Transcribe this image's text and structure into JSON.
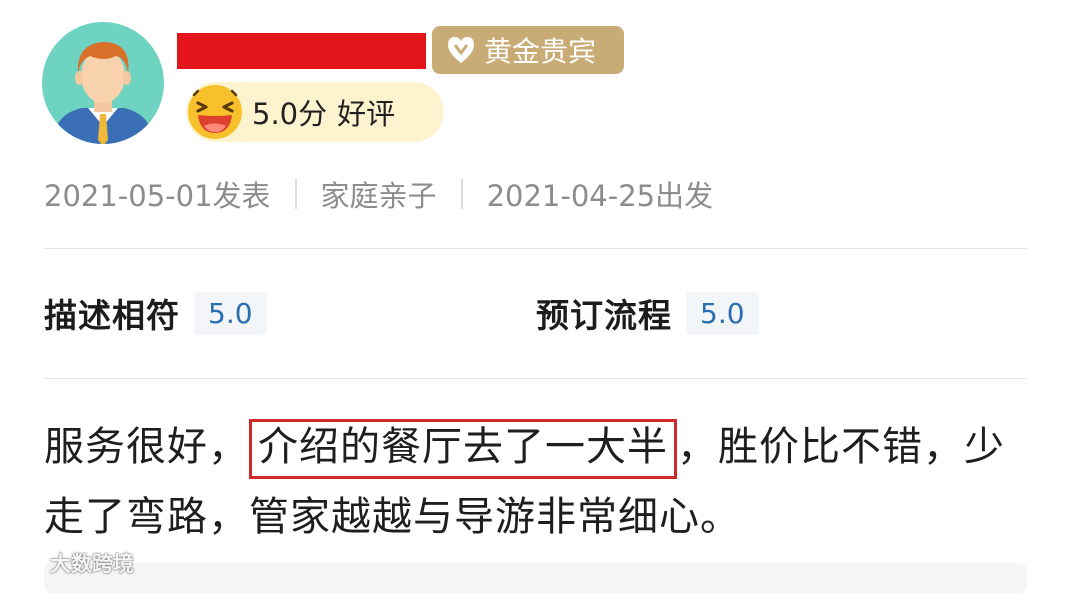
{
  "header": {
    "badge_label": "黄金贵宾",
    "rating_score": "5.0分",
    "rating_verdict": "好评"
  },
  "meta": {
    "posted": "2021-05-01发表",
    "trip_type": "家庭亲子",
    "departed": "2021-04-25出发"
  },
  "scores": [
    {
      "label": "描述相符",
      "value": "5.0"
    },
    {
      "label": "预订流程",
      "value": "5.0"
    }
  ],
  "review": {
    "before": "服务很好，",
    "highlighted": "介绍的餐厅去了一大半",
    "after": "，胜价比不错，少走了弯路，管家越越与导游非常细心。"
  },
  "watermark": "大数跨境",
  "colors": {
    "redaction": "#e3151b",
    "gold_badge": "#c9ab76",
    "rating_pill": "#fdf3cf",
    "score_value": "#2a6fb0",
    "highlight_border": "#cf2a2a"
  },
  "icons": {
    "avatar": "avatar-cartoon-man",
    "badge": "diamond-heart-icon",
    "rating": "laughing-emoji-icon"
  }
}
